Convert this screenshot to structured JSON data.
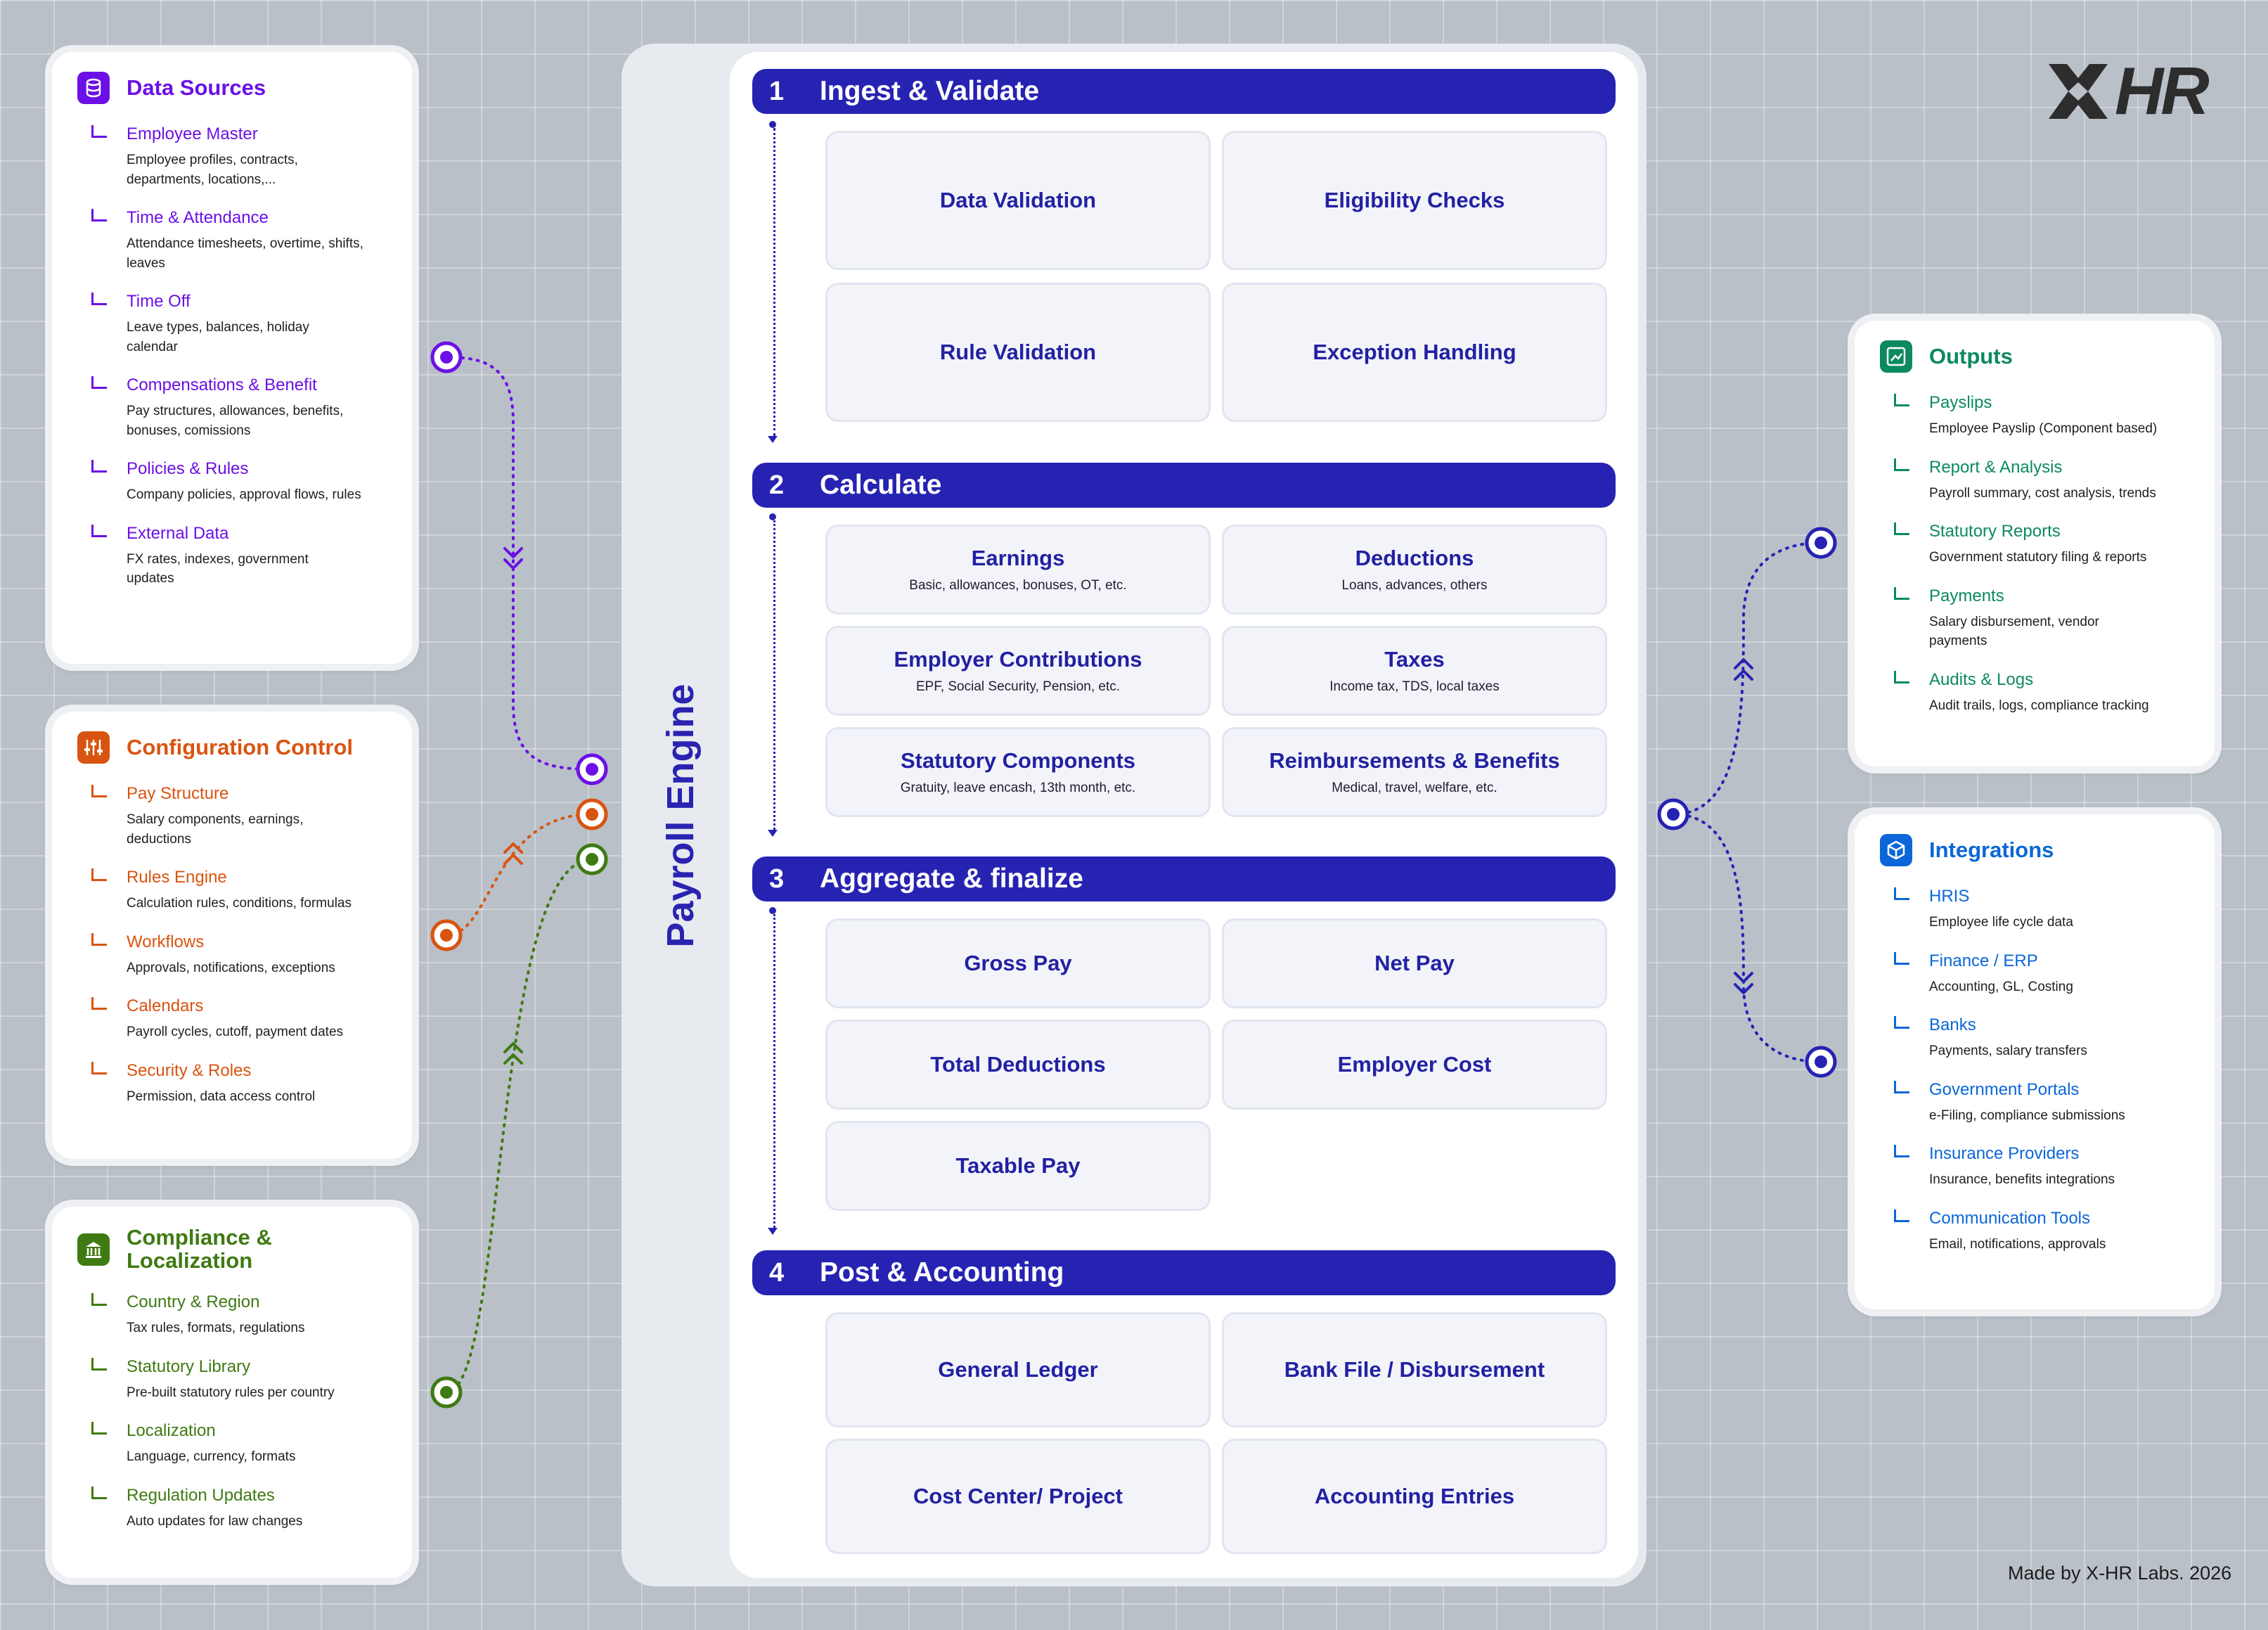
{
  "logo": {
    "text": "HR"
  },
  "footer": "Made by X-HR Labs. 2026",
  "engine": {
    "label": "Payroll Engine",
    "stages": [
      {
        "num": "1",
        "title": "Ingest & Validate",
        "tiles": [
          {
            "title": "Data Validation",
            "sub": ""
          },
          {
            "title": "Eligibility Checks",
            "sub": ""
          },
          {
            "title": "Rule Validation",
            "sub": ""
          },
          {
            "title": "Exception Handling",
            "sub": ""
          }
        ]
      },
      {
        "num": "2",
        "title": "Calculate",
        "tiles": [
          {
            "title": "Earnings",
            "sub": "Basic, allowances, bonuses, OT, etc."
          },
          {
            "title": "Deductions",
            "sub": "Loans, advances, others"
          },
          {
            "title": "Employer Contributions",
            "sub": "EPF, Social Security, Pension, etc."
          },
          {
            "title": "Taxes",
            "sub": "Income tax, TDS, local taxes"
          },
          {
            "title": "Statutory Components",
            "sub": "Gratuity, leave encash, 13th month, etc."
          },
          {
            "title": "Reimbursements & Benefits",
            "sub": "Medical, travel, welfare, etc."
          }
        ]
      },
      {
        "num": "3",
        "title": "Aggregate & finalize",
        "tiles": [
          {
            "title": "Gross Pay",
            "sub": ""
          },
          {
            "title": "Net Pay",
            "sub": ""
          },
          {
            "title": "Total Deductions",
            "sub": ""
          },
          {
            "title": "Employer Cost",
            "sub": ""
          },
          {
            "title": "Taxable Pay",
            "sub": ""
          }
        ]
      },
      {
        "num": "4",
        "title": "Post & Accounting",
        "tiles": [
          {
            "title": "General Ledger",
            "sub": ""
          },
          {
            "title": "Bank File / Disbursement",
            "sub": ""
          },
          {
            "title": "Cost Center/ Project",
            "sub": ""
          },
          {
            "title": "Accounting Entries",
            "sub": ""
          }
        ]
      }
    ]
  },
  "data_sources": {
    "title": "Data Sources",
    "icon": "database-icon",
    "color": "#6b10e6",
    "items": [
      {
        "title": "Employee Master",
        "desc": "Employee profiles, contracts, departments, locations,..."
      },
      {
        "title": "Time & Attendance",
        "desc": "Attendance timesheets, overtime, shifts, leaves"
      },
      {
        "title": "Time Off",
        "desc": "Leave types, balances, holiday calendar"
      },
      {
        "title": "Compensations & Benefit",
        "desc": "Pay structures, allowances, benefits, bonuses, comissions"
      },
      {
        "title": "Policies & Rules",
        "desc": "Company policies, approval flows, rules"
      },
      {
        "title": "External Data",
        "desc": "FX rates, indexes, government updates"
      }
    ]
  },
  "configuration": {
    "title": "Configuration Control",
    "icon": "sliders-icon",
    "color": "#d95410",
    "items": [
      {
        "title": "Pay Structure",
        "desc": "Salary components, earnings, deductions"
      },
      {
        "title": "Rules Engine",
        "desc": "Calculation rules, conditions, formulas"
      },
      {
        "title": "Workflows",
        "desc": "Approvals, notifications, exceptions"
      },
      {
        "title": "Calendars",
        "desc": "Payroll cycles, cutoff, payment dates"
      },
      {
        "title": "Security & Roles",
        "desc": "Permission, data access control"
      }
    ]
  },
  "compliance": {
    "title": "Compliance & Localization",
    "icon": "bank-icon",
    "color": "#3f7a13",
    "items": [
      {
        "title": "Country & Region",
        "desc": "Tax rules, formats, regulations"
      },
      {
        "title": "Statutory Library",
        "desc": "Pre-built statutory rules per country"
      },
      {
        "title": "Localization",
        "desc": "Language, currency, formats"
      },
      {
        "title": "Regulation Updates",
        "desc": "Auto updates for law changes"
      }
    ]
  },
  "outputs": {
    "title": "Outputs",
    "icon": "chart-icon",
    "color": "#0c8a5e",
    "items": [
      {
        "title": "Payslips",
        "desc": "Employee Payslip (Component based)"
      },
      {
        "title": "Report & Analysis",
        "desc": "Payroll summary, cost analysis, trends"
      },
      {
        "title": "Statutory Reports",
        "desc": "Government statutory filing & reports"
      },
      {
        "title": "Payments",
        "desc": "Salary disbursement, vendor payments"
      },
      {
        "title": "Audits & Logs",
        "desc": "Audit trails, logs, compliance tracking"
      }
    ]
  },
  "integrations": {
    "title": "Integrations",
    "icon": "cube-icon",
    "color": "#0b67d8",
    "items": [
      {
        "title": "HRIS",
        "desc": "Employee life cycle data"
      },
      {
        "title": "Finance / ERP",
        "desc": "Accounting, GL, Costing"
      },
      {
        "title": "Banks",
        "desc": "Payments, salary transfers"
      },
      {
        "title": "Government Portals",
        "desc": "e-Filing, compliance submissions"
      },
      {
        "title": "Insurance Providers",
        "desc": "Insurance, benefits integrations"
      },
      {
        "title": "Communication Tools",
        "desc": "Email, notifications, approvals"
      }
    ]
  }
}
